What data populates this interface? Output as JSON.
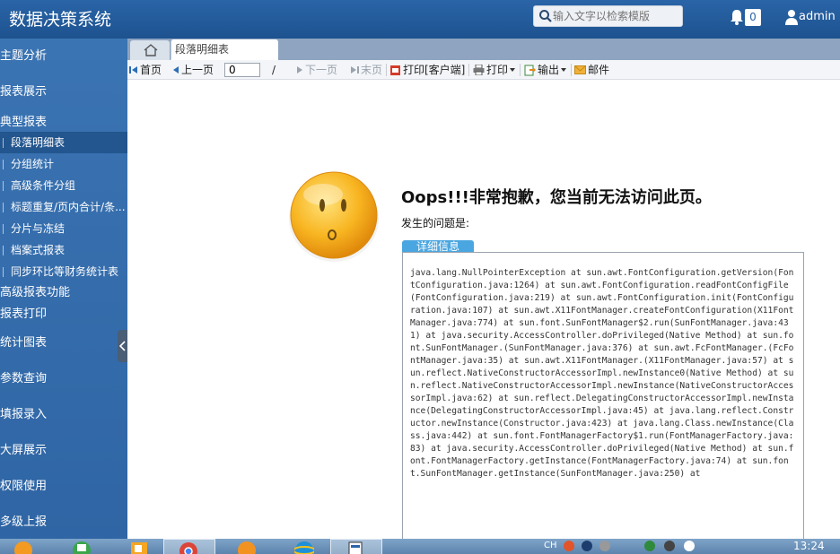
{
  "header": {
    "title": "数据决策系统",
    "search_placeholder": "输入文字以检索模版",
    "notification_count": "0",
    "user": "admin"
  },
  "sidebar": {
    "sections": [
      {
        "label": "主题分析"
      },
      {
        "label": "报表展示"
      },
      {
        "label": "典型报表"
      }
    ],
    "sub_items": [
      {
        "label": "段落明细表"
      },
      {
        "label": "分组统计"
      },
      {
        "label": "高级条件分组"
      },
      {
        "label": "标题重复/页内合计/条..."
      },
      {
        "label": "分片与冻结"
      },
      {
        "label": "档案式报表"
      },
      {
        "label": "同步环比等财务统计表"
      }
    ],
    "more": [
      {
        "label": "高级报表功能"
      },
      {
        "label": "报表打印"
      }
    ],
    "bottom": [
      {
        "label": "统计图表"
      },
      {
        "label": "参数查询"
      },
      {
        "label": "填报录入"
      },
      {
        "label": "大屏展示"
      },
      {
        "label": "权限使用"
      },
      {
        "label": "多级上报"
      }
    ]
  },
  "tabs": {
    "active_tab": "段落明细表"
  },
  "toolbar": {
    "first": "首页",
    "prev": "上一页",
    "page_value": "0",
    "slash": "/",
    "next": "下一页",
    "last": "末页",
    "print_client": "打印[客户端]",
    "print": "打印",
    "export": "输出",
    "mail": "邮件"
  },
  "error": {
    "title": "Oops!!!非常抱歉，您当前无法访问此页。",
    "problem_label": "发生的问题是:",
    "detail_button": "详细信息",
    "trace": "java.lang.NullPointerException at sun.awt.FontConfiguration.getVersion(FontConfiguration.java:1264) at sun.awt.FontConfiguration.readFontConfigFile(FontConfiguration.java:219) at sun.awt.FontConfiguration.init(FontConfiguration.java:107) at sun.awt.X11FontManager.createFontConfiguration(X11FontManager.java:774) at sun.font.SunFontManager$2.run(SunFontManager.java:431) at java.security.AccessController.doPrivileged(Native Method) at sun.font.SunFontManager.(SunFontManager.java:376) at sun.awt.FcFontManager.(FcFontManager.java:35) at sun.awt.X11FontManager.(X11FontManager.java:57) at sun.reflect.NativeConstructorAccessorImpl.newInstance0(Native Method) at sun.reflect.NativeConstructorAccessorImpl.newInstance(NativeConstructorAccessorImpl.java:62) at sun.reflect.DelegatingConstructorAccessorImpl.newInstance(DelegatingConstructorAccessorImpl.java:45) at java.lang.reflect.Constructor.newInstance(Constructor.java:423) at java.lang.Class.newInstance(Class.java:442) at sun.font.FontManagerFactory$1.run(FontManagerFactory.java:83) at java.security.AccessController.doPrivileged(Native Method) at sun.font.FontManagerFactory.getInstance(FontManagerFactory.java:74) at sun.font.SunFontManager.getInstance(SunFontManager.java:250) at"
  },
  "taskbar": {
    "tray_text": "CH",
    "clock": "13:24"
  },
  "colors": {
    "header": "#1d528f",
    "sidebar": "#3b74b3",
    "accent": "#4aa6e0"
  }
}
